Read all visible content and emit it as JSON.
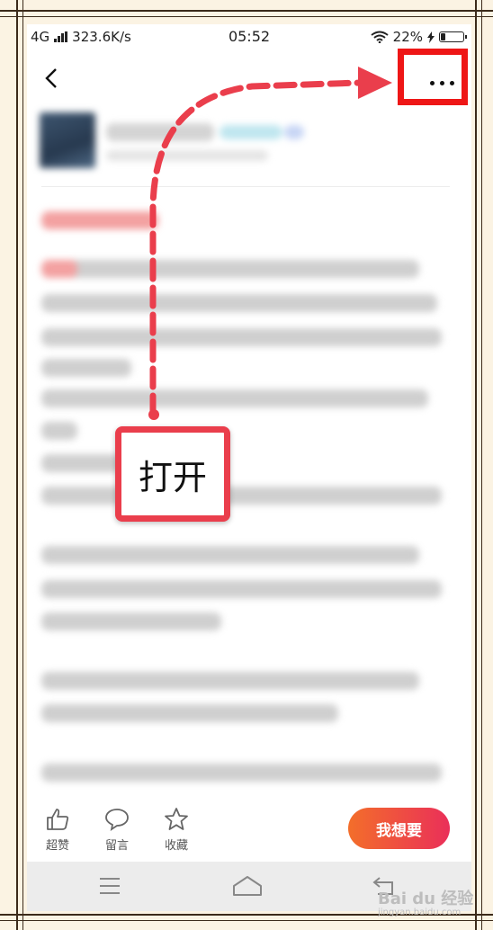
{
  "status": {
    "network": "4G",
    "speed": "323.6K/s",
    "time": "05:52",
    "battery_pct": "22%",
    "battery_level": 0.22
  },
  "callout": {
    "label": "打开"
  },
  "actions": {
    "like": "超赞",
    "comment": "留言",
    "favorite": "收藏",
    "want": "我想要"
  },
  "watermark": {
    "brand": "Bai du 经验",
    "url": "jingyan.baidu.com"
  },
  "colors": {
    "annotation_red": "#ea3e4c",
    "highlight_box": "#ee1616",
    "want_gradient_start": "#f36e2a",
    "want_gradient_end": "#ea2f59"
  }
}
